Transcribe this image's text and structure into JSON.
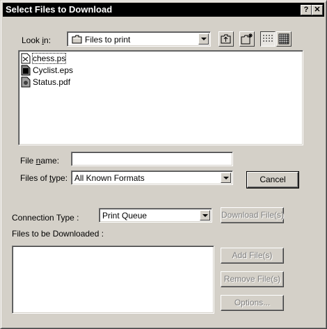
{
  "window": {
    "title": "Select Files to Download",
    "help_glyph": "?",
    "close_glyph": "✕"
  },
  "look_in": {
    "label_pre": "Look ",
    "label_ul": "i",
    "label_post": "n:",
    "value": "Files to print"
  },
  "files": [
    {
      "name": "chess.ps",
      "icon": "postscript-file-icon"
    },
    {
      "name": "Cyclist.eps",
      "icon": "eps-file-icon"
    },
    {
      "name": "Status.pdf",
      "icon": "pdf-file-icon"
    }
  ],
  "file_name": {
    "label_pre": "File ",
    "label_ul": "n",
    "label_post": "ame:",
    "value": ""
  },
  "files_of_type": {
    "label_pre": "Files of ",
    "label_ul": "t",
    "label_post": "ype:",
    "value": "All Known Formats"
  },
  "cancel_label": "Cancel",
  "connection": {
    "label": "Connection Type :",
    "value": "Print Queue"
  },
  "download_label": "Download File(s)",
  "files_to_download_label": "Files to be Downloaded :",
  "add_label": "Add File(s)",
  "remove_label": "Remove File(s)",
  "options_label": "Options..."
}
